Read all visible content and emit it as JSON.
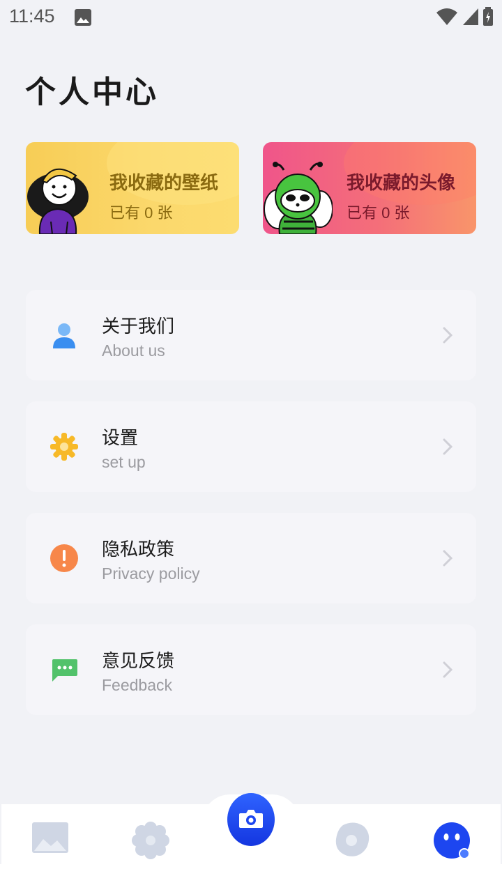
{
  "status_bar": {
    "time": "11:45"
  },
  "page": {
    "title": "个人中心"
  },
  "favorites": [
    {
      "title": "我收藏的壁纸",
      "count": "已有 0 张"
    },
    {
      "title": "我收藏的头像",
      "count": "已有 0 张"
    }
  ],
  "menu": [
    {
      "title": "关于我们",
      "subtitle": "About us",
      "icon": "person-icon",
      "color": "#4a9cf5"
    },
    {
      "title": "设置",
      "subtitle": "set up",
      "icon": "gear-icon",
      "color": "#f7b928"
    },
    {
      "title": "隐私政策",
      "subtitle": "Privacy policy",
      "icon": "alert-icon",
      "color": "#f7874a"
    },
    {
      "title": "意见反馈",
      "subtitle": "Feedback",
      "icon": "chat-icon",
      "color": "#52c26b"
    }
  ],
  "tabs": [
    {
      "icon": "image-icon"
    },
    {
      "icon": "flower-icon"
    },
    {
      "icon": "camera-icon"
    },
    {
      "icon": "blob-icon"
    },
    {
      "icon": "profile-face-icon"
    }
  ],
  "colors": {
    "accent": "#1d46f0",
    "inactive_tab": "#cfd6e4",
    "background": "#f1f2f6"
  }
}
